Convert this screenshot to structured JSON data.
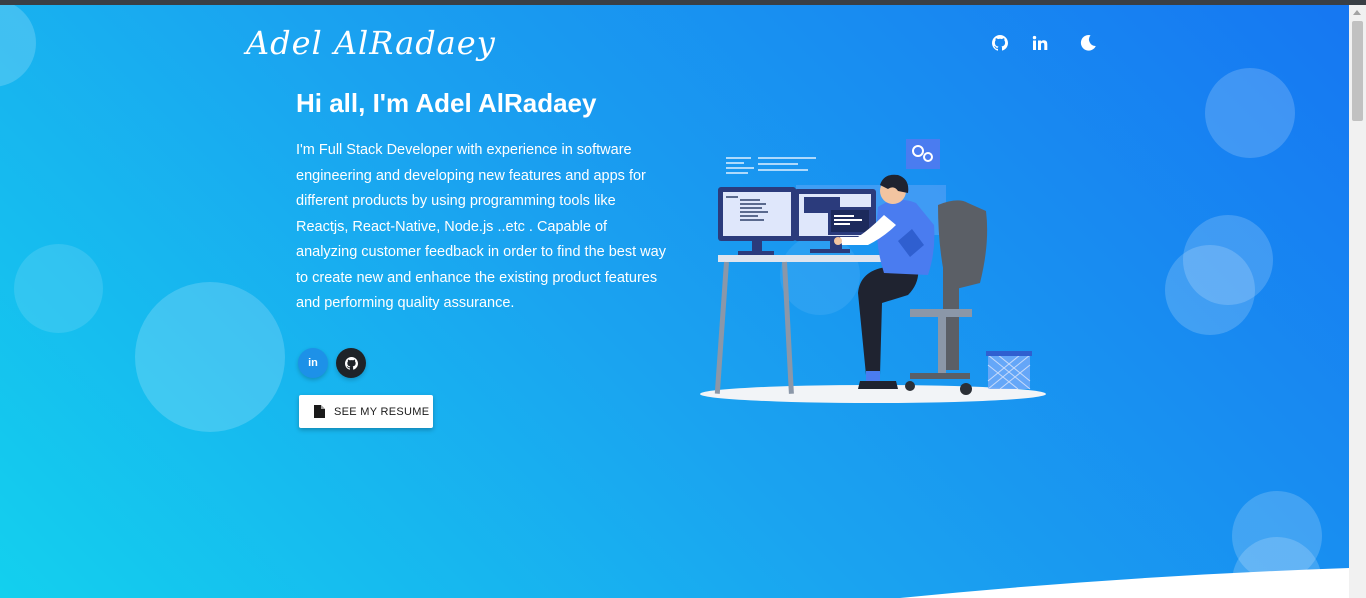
{
  "header": {
    "logo_text": "Adel AlRadaey",
    "icons": [
      "github-icon",
      "linkedin-icon",
      "moon-icon"
    ]
  },
  "hero": {
    "headline": "Hi all, I'm Adel AlRadaey",
    "intro": "I'm Full Stack Developer with experience in software engineering and developing new features and apps for different products by using programming tools like Reactjs, React-Native, Node.js ..etc . Capable of analyzing customer feedback in order to find the best way to create new and enhance the existing product features and performing quality assurance.",
    "social": [
      {
        "name": "linkedin",
        "label": "in",
        "color": "#1d91e8"
      },
      {
        "name": "github",
        "icon": "github-icon",
        "color": "#1f2328"
      }
    ],
    "resume_label": "SEE MY RESUME"
  },
  "colors": {
    "gradient_start": "#13d0ee",
    "gradient_mid": "#1aa3f0",
    "gradient_end": "#1677f2",
    "text": "#ffffff"
  }
}
